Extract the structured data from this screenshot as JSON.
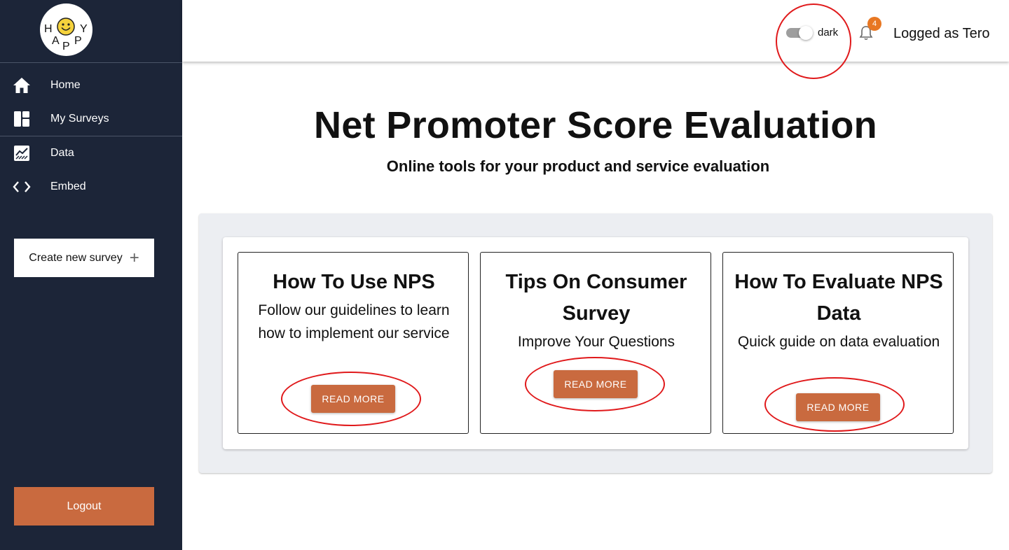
{
  "logo": {
    "letters": [
      "H",
      "Y",
      "A",
      "P",
      "P"
    ]
  },
  "sidebar": {
    "items": [
      {
        "label": "Home",
        "icon": "home-icon"
      },
      {
        "label": "My Surveys",
        "icon": "dashboard-icon"
      },
      {
        "label": "Data",
        "icon": "chart-icon"
      },
      {
        "label": "Embed",
        "icon": "code-icon"
      }
    ],
    "create_label": "Create new survey",
    "logout_label": "Logout"
  },
  "header": {
    "toggle_label": "dark",
    "notification_count": "4",
    "user_label": "Logged as Tero"
  },
  "main": {
    "title": "Net Promoter Score Evaluation",
    "subtitle": "Online tools for your product and service evaluation",
    "cards": [
      {
        "title": "How To Use NPS",
        "text": "Follow our guidelines to learn how to implement our service",
        "button": "READ MORE"
      },
      {
        "title": "Tips On Consumer Survey",
        "text": "Improve Your Questions",
        "button": "READ MORE"
      },
      {
        "title": "How To Evaluate NPS Data",
        "text": "Quick guide on data evaluation",
        "button": "READ MORE"
      }
    ]
  },
  "colors": {
    "sidebar_bg": "#1c2538",
    "accent": "#c96a3f",
    "badge": "#e87722",
    "annotation": "#e0191b",
    "panel_bg": "#eceef2"
  }
}
